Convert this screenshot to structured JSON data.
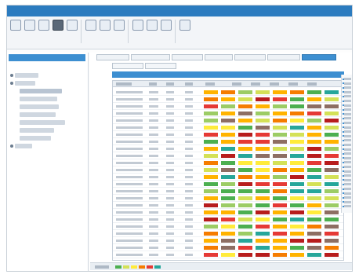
{
  "colors": {
    "accent": "#3d8fd1",
    "heat_scale": [
      "#4caf50",
      "#9ccc65",
      "#d4e157",
      "#ffeb3b",
      "#ffb300",
      "#f57c00",
      "#e53935",
      "#b71c1c",
      "#26a69a",
      "#8d6e63"
    ]
  }
}
